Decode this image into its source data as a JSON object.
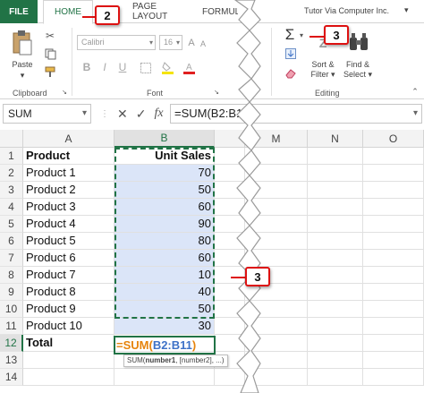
{
  "ribbon_tabs": {
    "file": "FILE",
    "home": "HOME",
    "page_layout": "PAGE LAYOUT",
    "formulas": "FORMUL"
  },
  "account": {
    "name": "Tutor Via Computer Inc.",
    "caret": "▾"
  },
  "ribbon": {
    "paste_label": "Paste",
    "clipboard_group": "Clipboard",
    "font_name": "Calibri",
    "font_size": "16",
    "font_group": "Font",
    "sort_filter": "Sort &",
    "sort_filter_2": "Filter ▾",
    "find_select": "Find &",
    "find_select_2": "Select ▾",
    "editing_group": "Editing",
    "sigma": "Σ",
    "sigma_caret": "▾"
  },
  "formula_bar": {
    "name_box": "SUM",
    "cancel": "✕",
    "enter": "✓",
    "fx": "fx",
    "formula": "=SUM(B2:B11",
    "caret": "▾"
  },
  "grid": {
    "columns": [
      "A",
      "B",
      "M",
      "N",
      "O"
    ],
    "rows": [
      {
        "n": "1",
        "a": "Product",
        "b": "Unit Sales"
      },
      {
        "n": "2",
        "a": "Product 1",
        "b": "70"
      },
      {
        "n": "3",
        "a": "Product 2",
        "b": "50"
      },
      {
        "n": "4",
        "a": "Product 3",
        "b": "60"
      },
      {
        "n": "5",
        "a": "Product 4",
        "b": "90"
      },
      {
        "n": "6",
        "a": "Product 5",
        "b": "80"
      },
      {
        "n": "7",
        "a": "Product 6",
        "b": "60"
      },
      {
        "n": "8",
        "a": "Product 7",
        "b": "10"
      },
      {
        "n": "9",
        "a": "Product 8",
        "b": "40"
      },
      {
        "n": "10",
        "a": "Product 9",
        "b": "50"
      },
      {
        "n": "11",
        "a": "Product 10",
        "b": "30"
      },
      {
        "n": "12",
        "a": "Total",
        "b": ""
      },
      {
        "n": "13",
        "a": "",
        "b": ""
      },
      {
        "n": "14",
        "a": "",
        "b": ""
      }
    ],
    "active_formula": {
      "eq": "=SUM(",
      "ref": "B2:B11",
      "close": ")"
    },
    "tooltip": {
      "fn": "SUM(",
      "arg1": "number1",
      "rest": ", [number2], ...)"
    }
  },
  "callouts": [
    "2",
    "3",
    "3"
  ],
  "colors": {
    "excel_green": "#217346",
    "range_fill": "#dbe5f8",
    "callout_red": "#dd1111",
    "formula_ref_blue": "#3e72c7",
    "formula_eq_orange": "#e6840d"
  }
}
